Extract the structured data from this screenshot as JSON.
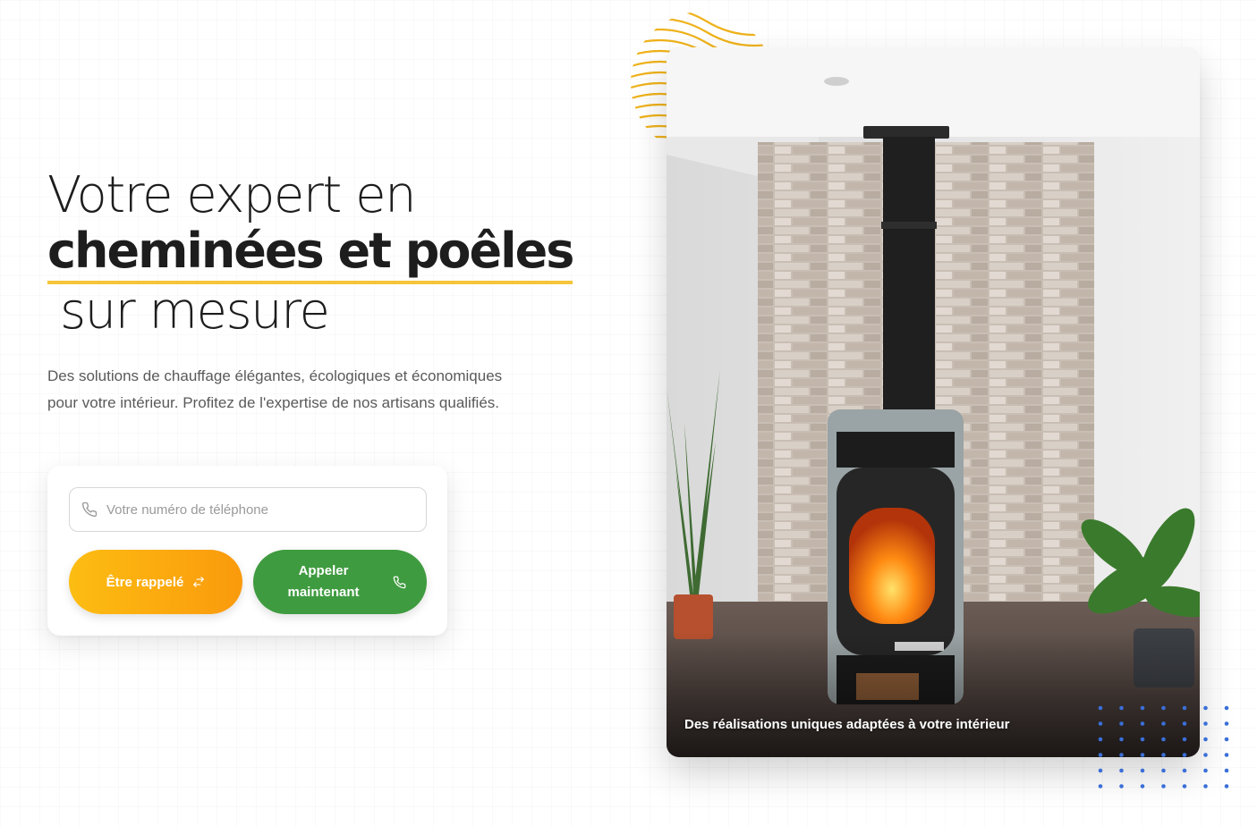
{
  "hero": {
    "title_line1": "Votre expert en",
    "title_line2": "cheminées et poêles",
    "title_line3": "sur mesure",
    "subtitle": "Des solutions de chauffage élégantes, écologiques et économiques pour votre intérieur. Profitez de l'expertise de nos artisans qualifiés."
  },
  "form": {
    "phone_placeholder": "Votre numéro de téléphone",
    "phone_value": "",
    "callback_label": "Être rappelé",
    "callnow_label": "Appeler maintenant"
  },
  "image": {
    "caption": "Des réalisations uniques adaptées à votre intérieur"
  },
  "icons": {
    "phone_input": "phone-icon",
    "callback": "swap-arrows-icon",
    "callnow": "phone-icon"
  },
  "colors": {
    "accent_yellow": "#f5c53a",
    "callback_gradient_start": "#fdbd12",
    "callback_gradient_end": "#fa9a0c",
    "callnow_green": "#3f9b3f",
    "dots_blue": "#3a6fd8",
    "deco_lines": "#efb21a"
  }
}
